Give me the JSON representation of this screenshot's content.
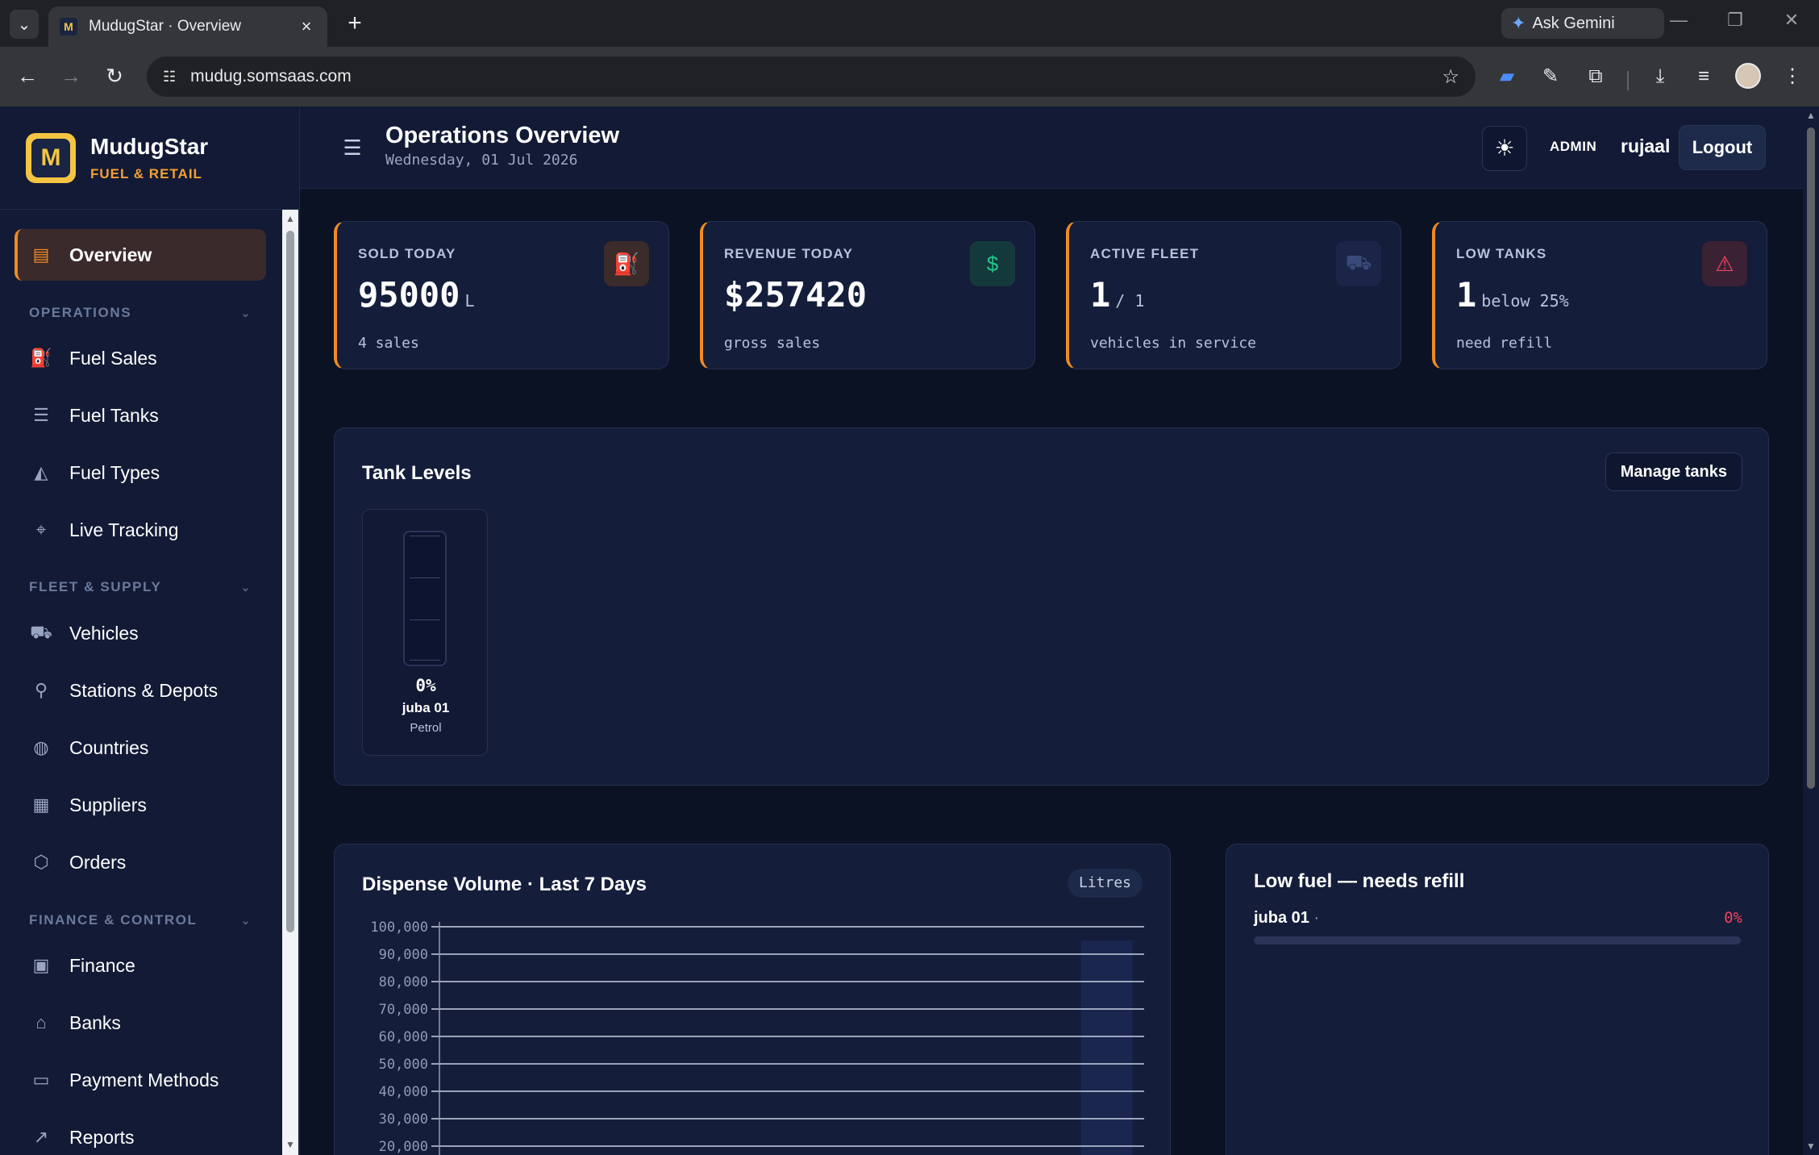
{
  "browser": {
    "tab_title": "MudugStar · Overview",
    "favicon": "M",
    "url": "mudug.somsaas.com",
    "ask_gemini": "Ask Gemini"
  },
  "brand": {
    "logo_letter": "M",
    "name": "MudugStar",
    "subtitle": "FUEL & RETAIL"
  },
  "sidebar": {
    "overview": "Overview",
    "sections": {
      "operations": "OPERATIONS",
      "fleet": "FLEET & SUPPLY",
      "finance": "FINANCE & CONTROL"
    },
    "items": {
      "fuel_sales": "Fuel Sales",
      "fuel_tanks": "Fuel Tanks",
      "fuel_types": "Fuel Types",
      "live_tracking": "Live Tracking",
      "vehicles": "Vehicles",
      "stations": "Stations & Depots",
      "countries": "Countries",
      "suppliers": "Suppliers",
      "orders": "Orders",
      "finance": "Finance",
      "banks": "Banks",
      "payment_methods": "Payment Methods",
      "reports": "Reports"
    }
  },
  "header": {
    "title": "Operations Overview",
    "date": "Wednesday, 01 Jul 2026",
    "role": "ADMIN",
    "username": "rujaal",
    "logout": "Logout"
  },
  "stats": {
    "sold": {
      "label": "SOLD TODAY",
      "value": "95000",
      "unit": "L",
      "sub": "4 sales"
    },
    "revenue": {
      "label": "REVENUE TODAY",
      "value": "$257420",
      "unit": "",
      "sub": "gross sales"
    },
    "fleet": {
      "label": "ACTIVE FLEET",
      "value": "1",
      "unit": "/ 1",
      "sub": "vehicles in service"
    },
    "low_tanks": {
      "label": "LOW TANKS",
      "value": "1",
      "unit": "below 25%",
      "sub": "need refill"
    }
  },
  "tank_levels": {
    "title": "Tank Levels",
    "manage_button": "Manage tanks",
    "tanks": [
      {
        "pct_label": "0%",
        "level": 0,
        "name": "juba 01",
        "type": "Petrol"
      }
    ]
  },
  "dispense_chart": {
    "title": "Dispense Volume · Last 7 Days",
    "unit_label": "Litres"
  },
  "chart_data": {
    "type": "bar",
    "title": "Dispense Volume · Last 7 Days",
    "ylabel": "Litres",
    "series": [
      {
        "values": [
          0,
          0,
          0,
          0,
          0,
          0,
          95000
        ]
      }
    ],
    "ylim": [
      0,
      100000
    ],
    "yticks": [
      "100,000",
      "90,000",
      "80,000",
      "70,000",
      "60,000",
      "50,000",
      "40,000",
      "30,000",
      "20,000"
    ],
    "grid": true,
    "bar_color": "#1b2750"
  },
  "low_fuel": {
    "title": "Low fuel — needs refill",
    "items": [
      {
        "name": "juba 01",
        "separator": "·",
        "pct_label": "0%",
        "level": 0
      }
    ]
  },
  "colors": {
    "accent": "#f08a24",
    "danger": "#f0445e",
    "success": "#22c58a",
    "brand": "#f4c542"
  }
}
